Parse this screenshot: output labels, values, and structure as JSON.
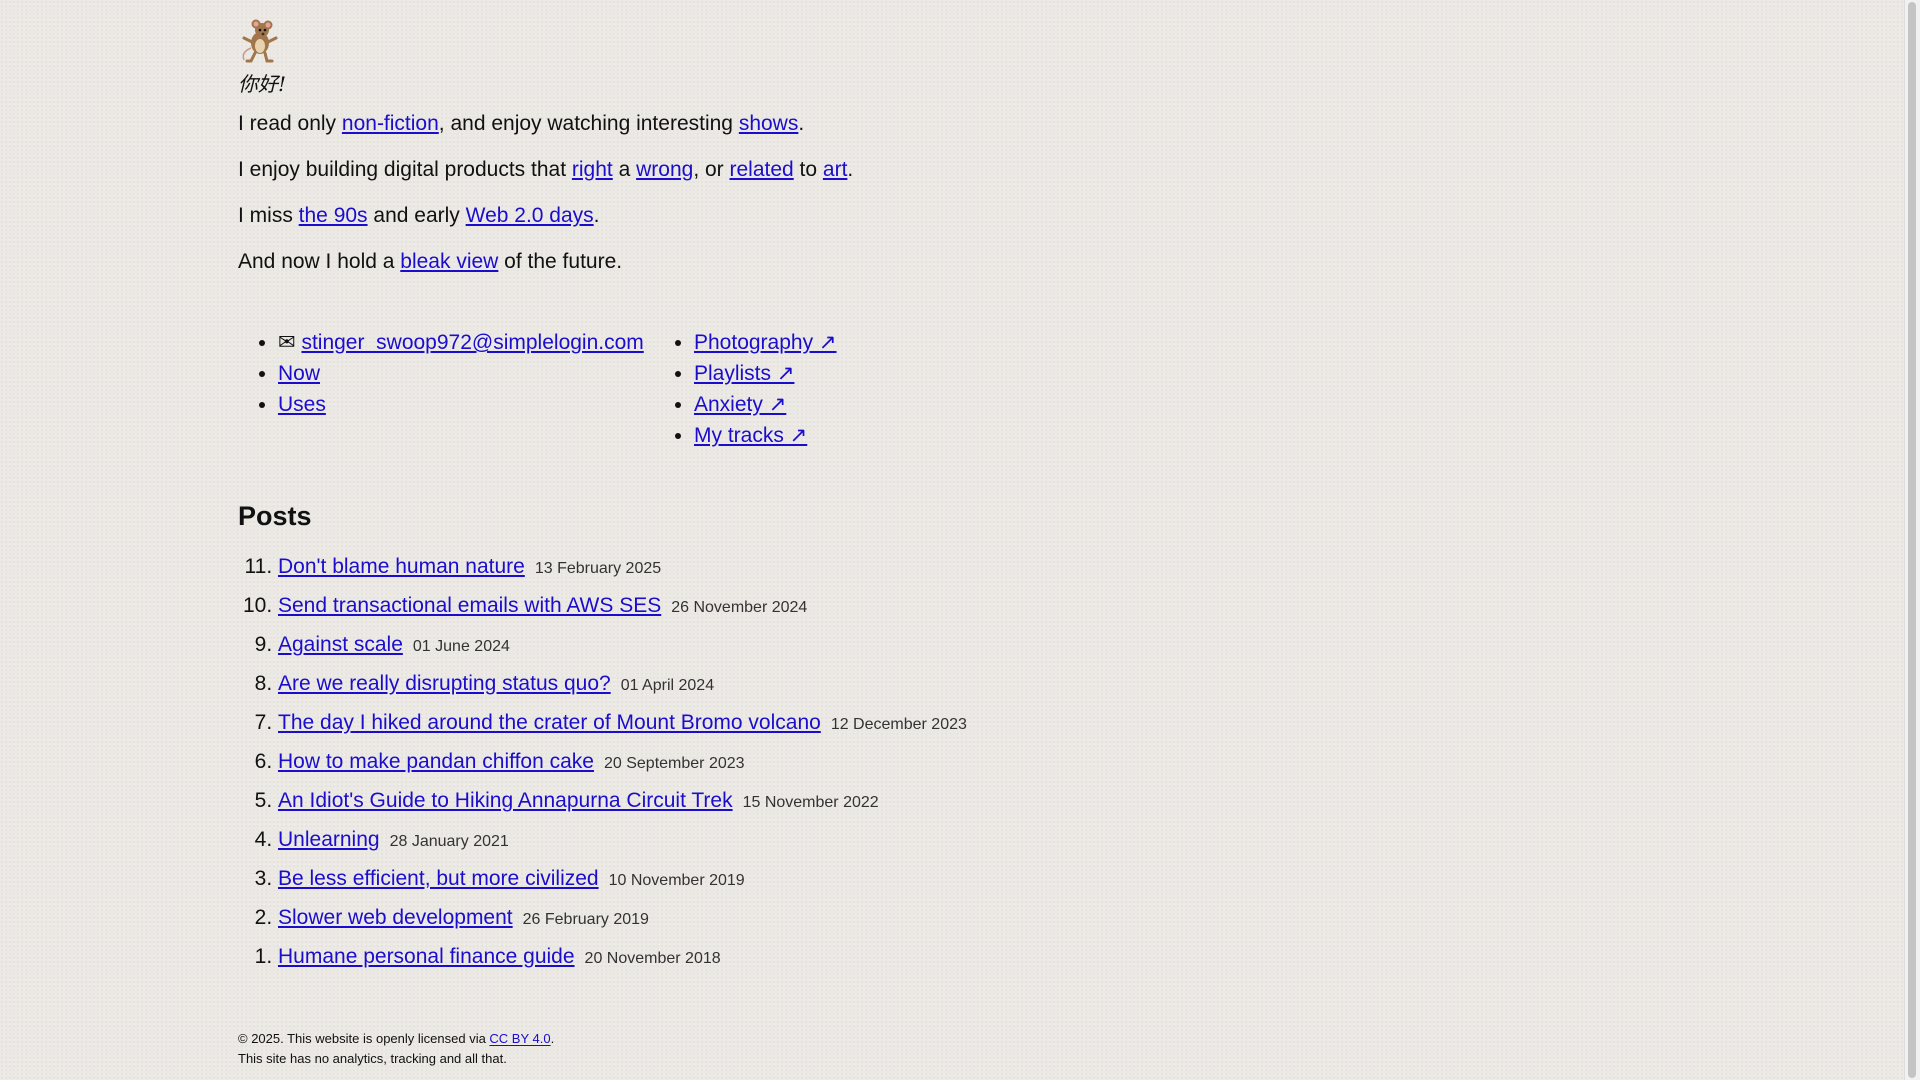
{
  "greeting": "你好!",
  "intro": {
    "p1": {
      "a": "I read only ",
      "link1": "non-fiction",
      "b": ", and enjoy watching interesting ",
      "link2": "shows",
      "c": "."
    },
    "p2": {
      "a": "I enjoy building digital products that ",
      "link1": "right",
      "b": " a ",
      "link2": "wrong",
      "c": ", or ",
      "link3": "related",
      "d": " to ",
      "link4": "art",
      "e": "."
    },
    "p3": {
      "a": "I miss ",
      "link1": "the 90s",
      "b": " and early ",
      "link2": "Web 2.0 days",
      "c": "."
    },
    "p4": {
      "a": "And now I hold a ",
      "link1": "bleak view",
      "b": " of the future."
    }
  },
  "links_left": {
    "email_icon": "✉",
    "email": "stinger_swoop972@simplelogin.com",
    "now": "Now",
    "uses": "Uses"
  },
  "links_right": {
    "photography": "Photography ↗",
    "playlists": "Playlists ↗",
    "anxiety": "Anxiety ↗",
    "tracks": "My tracks ↗"
  },
  "posts": {
    "heading": "Posts",
    "items": [
      {
        "title": "Don't blame human nature",
        "date": "13 February 2025"
      },
      {
        "title": "Send transactional emails with AWS SES",
        "date": "26 November 2024"
      },
      {
        "title": "Against scale",
        "date": "01 June 2024"
      },
      {
        "title": "Are we really disrupting status quo?",
        "date": "01 April 2024"
      },
      {
        "title": "The day I hiked around the crater of Mount Bromo volcano",
        "date": "12 December 2023"
      },
      {
        "title": "How to make pandan chiffon cake",
        "date": "20 September 2023"
      },
      {
        "title": "An Idiot's Guide to Hiking Annapurna Circuit Trek",
        "date": "15 November 2022"
      },
      {
        "title": "Unlearning",
        "date": "28 January 2021"
      },
      {
        "title": "Be less efficient, but more civilized",
        "date": "10 November 2019"
      },
      {
        "title": "Slower web development",
        "date": "26 February 2019"
      },
      {
        "title": "Humane personal finance guide",
        "date": "20 November 2018"
      }
    ]
  },
  "footer": {
    "line1_a": "© 2025. This website is openly licensed via ",
    "license": "CC BY 4.0",
    "line1_b": ".",
    "line2": "This site has no analytics, tracking and all that."
  }
}
